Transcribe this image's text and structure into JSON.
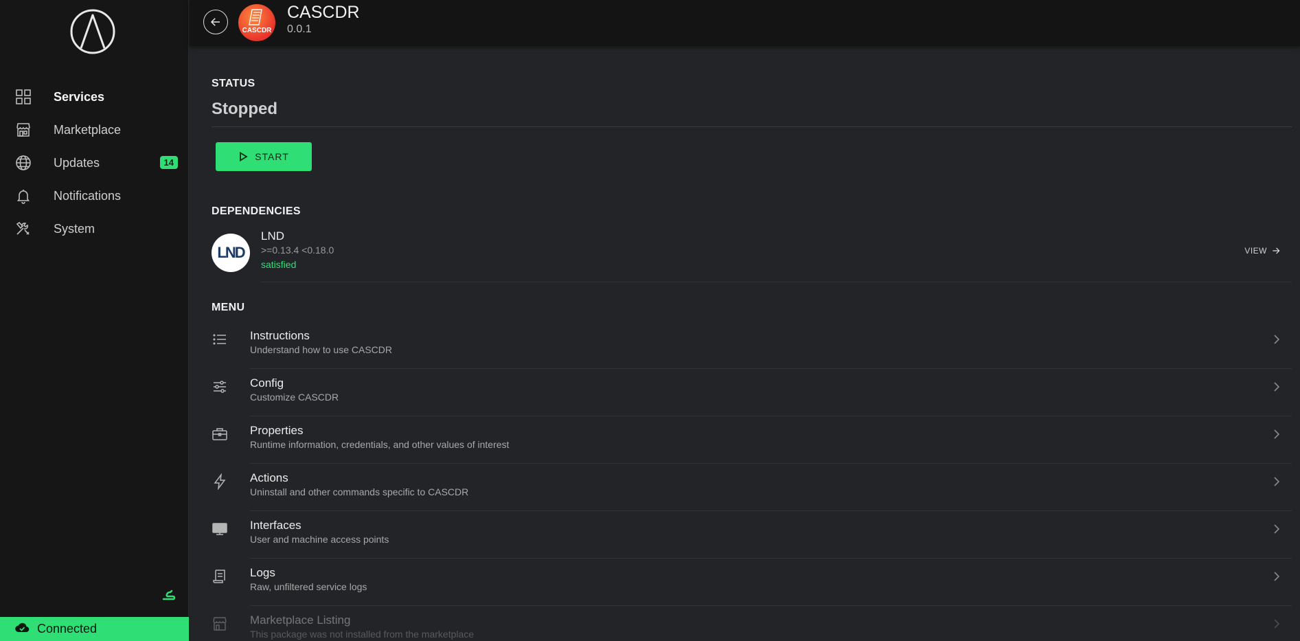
{
  "sidebar": {
    "items": [
      {
        "label": "Services",
        "icon": "grid-icon",
        "active": true
      },
      {
        "label": "Marketplace",
        "icon": "storefront-icon"
      },
      {
        "label": "Updates",
        "icon": "globe-icon",
        "badge": "14"
      },
      {
        "label": "Notifications",
        "icon": "bell-icon"
      },
      {
        "label": "System",
        "icon": "tools-icon"
      }
    ],
    "connection": "Connected"
  },
  "header": {
    "app_name": "CASCDR",
    "version": "0.0.1",
    "app_icon_text": "CASCDR"
  },
  "status": {
    "section_title": "STATUS",
    "value": "Stopped",
    "start_label": "START"
  },
  "dependencies": {
    "section_title": "DEPENDENCIES",
    "items": [
      {
        "name": "LND",
        "avatar_text": "LND",
        "version_range": ">=0.13.4 <0.18.0",
        "state": "satisfied",
        "view_label": "VIEW"
      }
    ]
  },
  "menu": {
    "section_title": "MENU",
    "items": [
      {
        "title": "Instructions",
        "subtitle": "Understand how to use CASCDR",
        "icon": "list-icon"
      },
      {
        "title": "Config",
        "subtitle": "Customize CASCDR",
        "icon": "sliders-icon"
      },
      {
        "title": "Properties",
        "subtitle": "Runtime information, credentials, and other values of interest",
        "icon": "briefcase-icon"
      },
      {
        "title": "Actions",
        "subtitle": "Uninstall and other commands specific to CASCDR",
        "icon": "flash-icon"
      },
      {
        "title": "Interfaces",
        "subtitle": "User and machine access points",
        "icon": "desktop-icon"
      },
      {
        "title": "Logs",
        "subtitle": "Raw, unfiltered service logs",
        "icon": "receipt-icon"
      },
      {
        "title": "Marketplace Listing",
        "subtitle": "This package was not installed from the marketplace",
        "icon": "storefront-icon",
        "disabled": true
      }
    ]
  },
  "colors": {
    "accent": "#2fdf75",
    "background": "#222428",
    "sidebar": "#161616"
  }
}
